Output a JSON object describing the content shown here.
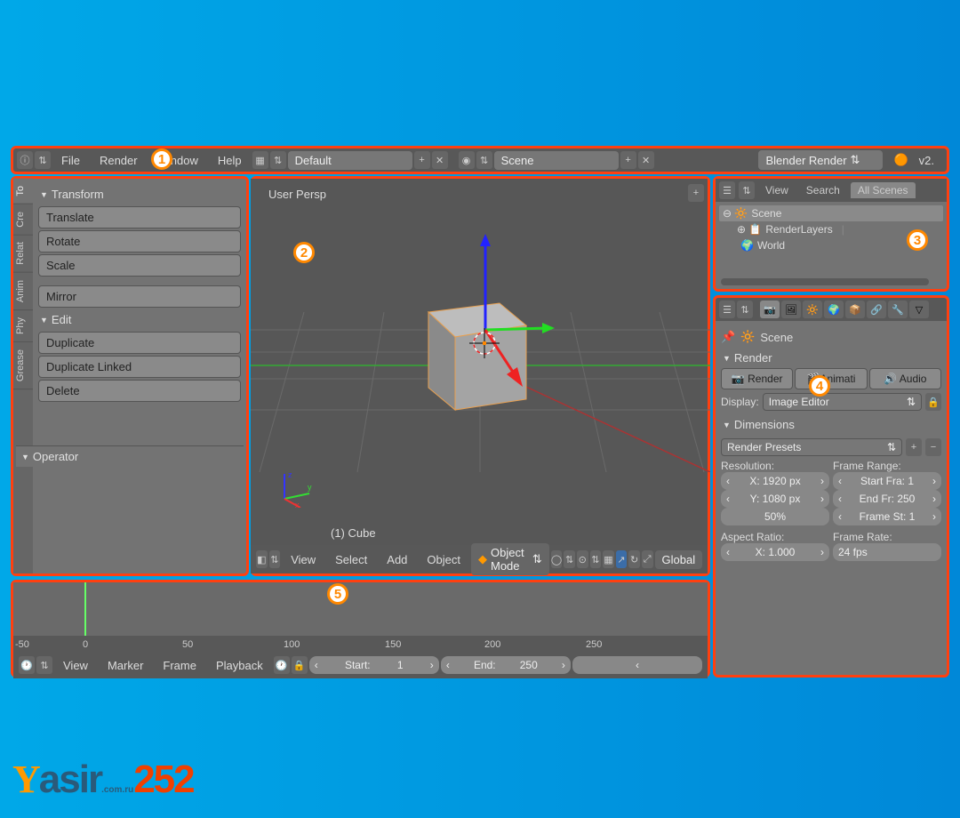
{
  "topbar": {
    "menus": [
      "File",
      "Render",
      "Window",
      "Help"
    ],
    "layout": "Default",
    "scene": "Scene",
    "engine": "Blender Render",
    "version": "v2."
  },
  "toolshelf": {
    "tabs": [
      "To",
      "Cre",
      "Relat",
      "Anim",
      "Phy",
      "Grease"
    ],
    "transform": {
      "title": "Transform",
      "items": [
        "Translate",
        "Rotate",
        "Scale",
        "Mirror"
      ]
    },
    "edit": {
      "title": "Edit",
      "items": [
        "Duplicate",
        "Duplicate Linked",
        "Delete"
      ]
    },
    "operator": "Operator"
  },
  "viewport": {
    "persp": "User Persp",
    "obj": "(1) Cube",
    "header": {
      "menus": [
        "View",
        "Select",
        "Add",
        "Object"
      ],
      "mode": "Object Mode",
      "orient": "Global"
    }
  },
  "outliner": {
    "menus": [
      "View",
      "Search"
    ],
    "tab_active": "All Scenes",
    "tree": {
      "scene": "Scene",
      "renderlayers": "RenderLayers",
      "world": "World"
    }
  },
  "properties": {
    "breadcrumb": "Scene",
    "render": {
      "title": "Render",
      "buttons": {
        "render": "Render",
        "anim": "Animati",
        "audio": "Audio"
      },
      "display_label": "Display:",
      "display_value": "Image Editor"
    },
    "dimensions": {
      "title": "Dimensions",
      "preset": "Render Presets",
      "res_label": "Resolution:",
      "res_x": "X: 1920 px",
      "res_y": "Y: 1080 px",
      "res_pct": "50%",
      "aspect_label": "Aspect Ratio:",
      "aspect_x": "X:   1.000",
      "frame_label": "Frame Range:",
      "frame_start": "Start Fra:  1",
      "frame_end": "End Fr: 250",
      "frame_step": "Frame St: 1",
      "rate_label": "Frame Rate:",
      "rate": "24 fps"
    }
  },
  "timeline": {
    "ticks": [
      "-50",
      "0",
      "50",
      "100",
      "150",
      "200",
      "250"
    ],
    "menus": [
      "View",
      "Marker",
      "Frame",
      "Playback"
    ],
    "start_label": "Start:",
    "start_val": "1",
    "end_label": "End:",
    "end_val": "250"
  },
  "callouts": {
    "c1": "1",
    "c2": "2",
    "c3": "3",
    "c4": "4",
    "c5": "5"
  },
  "logo": {
    "y": "Y",
    "rest": "asir",
    "num": "252",
    "sub": ".com.ru"
  }
}
